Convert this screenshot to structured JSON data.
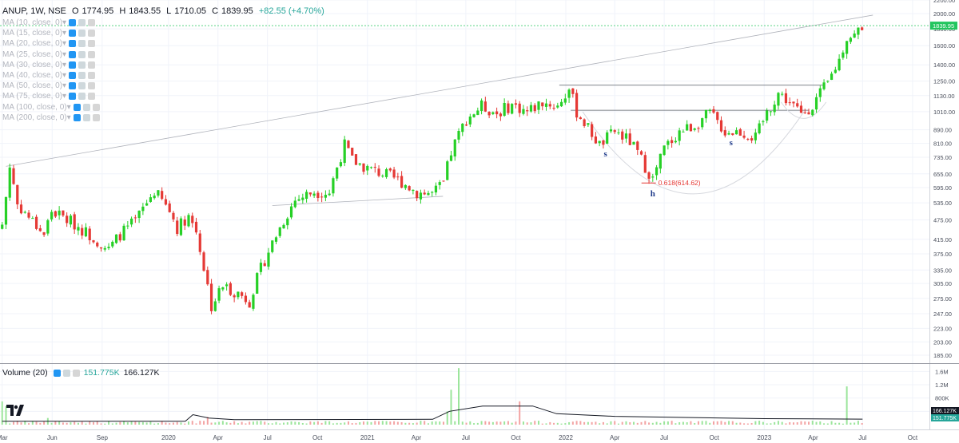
{
  "header": {
    "symbol": "ANUP, 1W, NSE",
    "open_label": "O",
    "open": "1774.95",
    "high_label": "H",
    "high": "1843.55",
    "low_label": "L",
    "low": "1710.05",
    "close_label": "C",
    "close": "1839.95",
    "change": "+82.55 (+4.70%)"
  },
  "ma_indicators": [
    "MA (10, close, 0)",
    "MA (15, close, 0)",
    "MA (20, close, 0)",
    "MA (25, close, 0)",
    "MA (30, close, 0)",
    "MA (40, close, 0)",
    "MA (50, close, 0)",
    "MA (75, close, 0)",
    "MA (100, close, 0)",
    "MA (200, close, 0)"
  ],
  "volume_panel": {
    "name": "Volume (20)",
    "volume": "151.775K",
    "volume_ma": "166.127K"
  },
  "colors": {
    "up": "#26d026",
    "down": "#e53935",
    "grid": "#f0f3fa",
    "price_line": "#22c55e",
    "annotation_red": "#e53935",
    "annotation_blue": "#1e3a8a"
  },
  "chart_data": {
    "type": "candlestick",
    "timeframe": "1W",
    "price_axis": {
      "scale": "log",
      "range": [
        175,
        2200
      ],
      "ticks": [
        "2200.00",
        "2000.00",
        "1800.00",
        "1600.00",
        "1400.00",
        "1250.00",
        "1130.00",
        "1010.00",
        "890.00",
        "810.00",
        "735.00",
        "655.00",
        "595.00",
        "535.00",
        "475.00",
        "415.00",
        "375.00",
        "335.00",
        "305.00",
        "275.00",
        "247.00",
        "223.00",
        "203.00",
        "185.00"
      ]
    },
    "time_axis": {
      "range": [
        "2019-02-25",
        "2023-11-01"
      ],
      "ticks": [
        {
          "date": "2019-03-01",
          "label": "Mar"
        },
        {
          "date": "2019-06-01",
          "label": "Jun"
        },
        {
          "date": "2019-09-01",
          "label": "Sep"
        },
        {
          "date": "2020-01-01",
          "label": "2020"
        },
        {
          "date": "2020-04-01",
          "label": "Apr"
        },
        {
          "date": "2020-07-01",
          "label": "Jul"
        },
        {
          "date": "2020-10-01",
          "label": "Oct"
        },
        {
          "date": "2021-01-01",
          "label": "2021"
        },
        {
          "date": "2021-04-01",
          "label": "Apr"
        },
        {
          "date": "2021-07-01",
          "label": "Jul"
        },
        {
          "date": "2021-10-01",
          "label": "Oct"
        },
        {
          "date": "2022-01-01",
          "label": "2022"
        },
        {
          "date": "2022-04-01",
          "label": "Apr"
        },
        {
          "date": "2022-07-01",
          "label": "Jul"
        },
        {
          "date": "2022-10-01",
          "label": "Oct"
        },
        {
          "date": "2023-01-01",
          "label": "2023"
        },
        {
          "date": "2023-04-01",
          "label": "Apr"
        },
        {
          "date": "2023-07-01",
          "label": "Jul"
        },
        {
          "date": "2023-10-01",
          "label": "Oct"
        }
      ]
    },
    "last_price_label": "1839.95",
    "volume_axis": {
      "range": [
        0,
        1800000
      ],
      "ticks": [
        "1.6M",
        "1.2M",
        "800K",
        "400K"
      ],
      "last_labels": [
        "166.127K",
        "151.775K"
      ]
    },
    "price_path": [
      [
        "2019-03-01",
        460
      ],
      [
        "2019-03-08",
        560
      ],
      [
        "2019-03-15",
        690
      ],
      [
        "2019-03-29",
        530
      ],
      [
        "2019-04-26",
        470
      ],
      [
        "2019-05-17",
        430
      ],
      [
        "2019-05-31",
        505
      ],
      [
        "2019-07-05",
        470
      ],
      [
        "2019-08-16",
        420
      ],
      [
        "2019-09-13",
        385
      ],
      [
        "2019-10-04",
        430
      ],
      [
        "2019-11-01",
        470
      ],
      [
        "2019-12-06",
        580
      ],
      [
        "2020-01-03",
        505
      ],
      [
        "2020-01-17",
        450
      ],
      [
        "2020-02-07",
        490
      ],
      [
        "2020-02-21",
        440
      ],
      [
        "2020-03-06",
        340
      ],
      [
        "2020-03-20",
        260
      ],
      [
        "2020-04-10",
        300
      ],
      [
        "2020-05-08",
        285
      ],
      [
        "2020-05-29",
        270
      ],
      [
        "2020-06-26",
        360
      ],
      [
        "2020-07-24",
        450
      ],
      [
        "2020-08-21",
        545
      ],
      [
        "2020-09-25",
        580
      ],
      [
        "2020-10-23",
        575
      ],
      [
        "2020-11-20",
        800
      ],
      [
        "2020-12-04",
        720
      ],
      [
        "2021-01-01",
        680
      ],
      [
        "2021-02-05",
        650
      ],
      [
        "2021-03-05",
        620
      ],
      [
        "2021-04-02",
        575
      ],
      [
        "2021-04-30",
        570
      ],
      [
        "2021-05-21",
        610
      ],
      [
        "2021-06-04",
        760
      ],
      [
        "2021-07-02",
        960
      ],
      [
        "2021-07-30",
        1050
      ],
      [
        "2021-08-27",
        1000
      ],
      [
        "2021-09-24",
        1060
      ],
      [
        "2021-10-22",
        1010
      ],
      [
        "2021-11-19",
        1080
      ],
      [
        "2021-12-17",
        1050
      ],
      [
        "2022-01-07",
        1180
      ],
      [
        "2022-01-21",
        1010
      ],
      [
        "2022-02-11",
        900
      ],
      [
        "2022-03-04",
        800
      ],
      [
        "2022-04-01",
        880
      ],
      [
        "2022-04-29",
        820
      ],
      [
        "2022-05-27",
        690
      ],
      [
        "2022-06-10",
        630
      ],
      [
        "2022-07-01",
        780
      ],
      [
        "2022-07-29",
        880
      ],
      [
        "2022-08-26",
        920
      ],
      [
        "2022-09-23",
        1000
      ],
      [
        "2022-10-21",
        880
      ],
      [
        "2022-11-18",
        880
      ],
      [
        "2022-12-16",
        840
      ],
      [
        "2023-01-06",
        1000
      ],
      [
        "2023-01-27",
        1150
      ],
      [
        "2023-02-17",
        1080
      ],
      [
        "2023-03-10",
        990
      ],
      [
        "2023-03-31",
        1060
      ],
      [
        "2023-04-28",
        1230
      ],
      [
        "2023-05-19",
        1450
      ],
      [
        "2023-06-02",
        1700
      ],
      [
        "2023-06-16",
        1720
      ],
      [
        "2023-06-30",
        1840
      ]
    ],
    "volume_spikes": [
      [
        "2019-03-01",
        700000
      ],
      [
        "2019-03-08",
        560000
      ],
      [
        "2019-05-24",
        200000
      ],
      [
        "2020-03-13",
        230000
      ],
      [
        "2021-05-28",
        400000
      ],
      [
        "2021-06-04",
        1050000
      ],
      [
        "2021-06-18",
        1700000
      ],
      [
        "2021-10-08",
        700000
      ],
      [
        "2023-06-02",
        1150000
      ]
    ],
    "volume_ma_path": [
      [
        "2019-03-01",
        100000
      ],
      [
        "2020-02-01",
        100000
      ],
      [
        "2020-02-15",
        300000
      ],
      [
        "2020-03-15",
        200000
      ],
      [
        "2020-05-01",
        150000
      ],
      [
        "2021-05-01",
        160000
      ],
      [
        "2021-06-01",
        400000
      ],
      [
        "2021-08-01",
        560000
      ],
      [
        "2021-11-01",
        560000
      ],
      [
        "2021-12-15",
        330000
      ],
      [
        "2022-04-01",
        250000
      ],
      [
        "2023-01-01",
        180000
      ],
      [
        "2023-07-01",
        166127
      ]
    ],
    "annotations": [
      {
        "type": "label",
        "text": "s",
        "date": "2022-03-15",
        "price": 740
      },
      {
        "type": "label",
        "text": "h",
        "date": "2022-06-10",
        "price": 560
      },
      {
        "type": "label",
        "text": "s",
        "date": "2022-11-01",
        "price": 800
      },
      {
        "type": "fib",
        "text": "0.618(614.62)",
        "date": "2022-06-01",
        "price": 614.62
      },
      {
        "type": "trendline",
        "from": [
          "2019-03-08",
          690
        ],
        "to": [
          "2023-07-20",
          1980
        ]
      },
      {
        "type": "hline",
        "from": "2021-12-20",
        "to": "2023-04-20",
        "price": 1215
      },
      {
        "type": "hline",
        "from": "2022-01-10",
        "to": "2023-03-25",
        "price": 1020
      },
      {
        "type": "trendline",
        "from": [
          "2020-07-10",
          525
        ],
        "to": [
          "2021-05-20",
          560
        ]
      }
    ]
  }
}
